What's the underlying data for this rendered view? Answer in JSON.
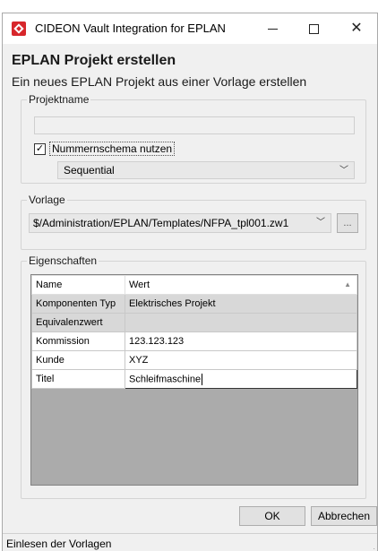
{
  "window": {
    "title": "CIDEON Vault Integration for EPLAN",
    "icon": "cideon-logo-icon",
    "controls": {
      "minimize_icon": "minimize-icon",
      "maximize_icon": "maximize-icon",
      "close_glyph": "✕"
    }
  },
  "header": {
    "title": "EPLAN Projekt erstellen",
    "subtitle": "Ein neues EPLAN Projekt aus einer Vorlage erstellen"
  },
  "projektname": {
    "group_label": "Projektname",
    "input_value": "",
    "checkbox_label": "Nummernschema nutzen",
    "checkbox_checked": true,
    "checkbox_glyph": "✓",
    "scheme_value": "Sequential",
    "chevron": "﹀"
  },
  "vorlage": {
    "group_label": "Vorlage",
    "value": "$/Administration/EPLAN/Templates/NFPA_tpl001.zw1",
    "chevron": "﹀",
    "browse_label": "..."
  },
  "eigenschaften": {
    "group_label": "Eigenschaften",
    "columns": [
      "Name",
      "Wert"
    ],
    "sort_glyph": "▲",
    "rows": [
      {
        "name": "Komponenten Typ",
        "value": "Elektrisches Projekt"
      },
      {
        "name": "Equivalenzwert",
        "value": ""
      },
      {
        "name": "Kommission",
        "value": "123.123.123"
      },
      {
        "name": "Kunde",
        "value": "XYZ"
      },
      {
        "name": "Titel",
        "value": "Schleifmaschine"
      }
    ]
  },
  "buttons": {
    "ok": "OK",
    "cancel": "Abbrechen"
  },
  "status": {
    "text": "Einlesen der Vorlagen",
    "grip": "⋰"
  },
  "colors": {
    "brand": "#d7262b",
    "window_bg": "#f0f0f0",
    "readonly_row": "#d8d8d8"
  }
}
